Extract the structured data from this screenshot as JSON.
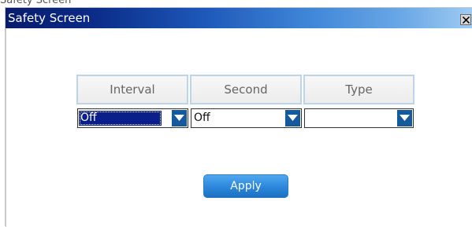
{
  "outer_caption": "Safety Screen",
  "dialog": {
    "title": "Safety Screen",
    "close_icon": "close-icon"
  },
  "columns": [
    {
      "header": "Interval",
      "value": "Off",
      "selected": true
    },
    {
      "header": "Second",
      "value": "Off",
      "selected": false
    },
    {
      "header": "Type",
      "value": "",
      "selected": false
    }
  ],
  "apply_label": "Apply",
  "colors": {
    "titlebar_start": "#071c6c",
    "titlebar_end": "#9ecbf2",
    "dropdown_arrow": "#145a9c",
    "apply_button": "#2a87db",
    "selection": "#0b1f8a"
  }
}
